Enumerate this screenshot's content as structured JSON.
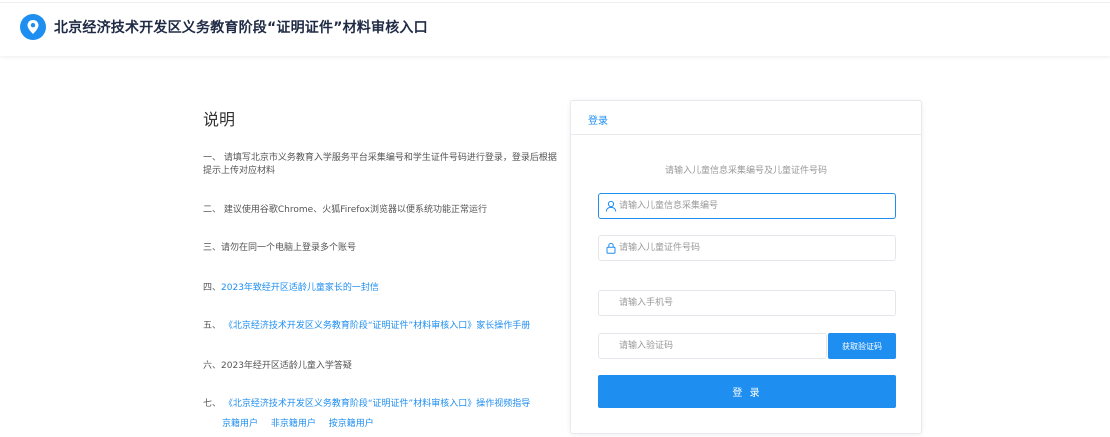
{
  "header": {
    "title": "北京经济技术开发区义务教育阶段“证明证件”材料审核入口",
    "brand_color": "#1f8ef1"
  },
  "instructions": {
    "title": "说明",
    "items": [
      {
        "prefix": "一、",
        "text": "请填写北京市义务教育入学服务平台采集编号和学生证件号码进行登录，登录后根据提示上传对应材料"
      },
      {
        "prefix": "二、",
        "text": "建议使用谷歌Chrome、火狐Firefox浏览器以便系统功能正常运行"
      },
      {
        "prefix": "三、",
        "text": "请勿在同一个电脑上登录多个账号"
      },
      {
        "prefix": "四、",
        "link": "2023年致经开区适龄儿童家长的一封信"
      },
      {
        "prefix": "五、",
        "link": "《北京经济技术开发区义务教育阶段“证明证件”材料审核入口》家长操作手册"
      },
      {
        "prefix": "六、",
        "text": "2023年经开区适龄儿童入学答疑"
      },
      {
        "prefix": "七、",
        "link": "《北京经济技术开发区义务教育阶段“证明证件”材料审核入口》操作视频指导"
      }
    ],
    "video_links": [
      "京籍用户",
      "非京籍用户",
      "按京籍用户"
    ]
  },
  "login": {
    "tab_label": "登录",
    "hint": "请输入儿童信息采集编号及儿童证件号码",
    "fields": {
      "collection_no": {
        "placeholder": "请输入儿童信息采集编号",
        "icon": "user-icon"
      },
      "id_no": {
        "placeholder": "请输入儿童证件号码",
        "icon": "lock-icon"
      },
      "phone": {
        "placeholder": "请输入手机号"
      },
      "code": {
        "placeholder": "请输入验证码"
      }
    },
    "sms_button": "获取验证码",
    "submit_button": "登 录"
  }
}
